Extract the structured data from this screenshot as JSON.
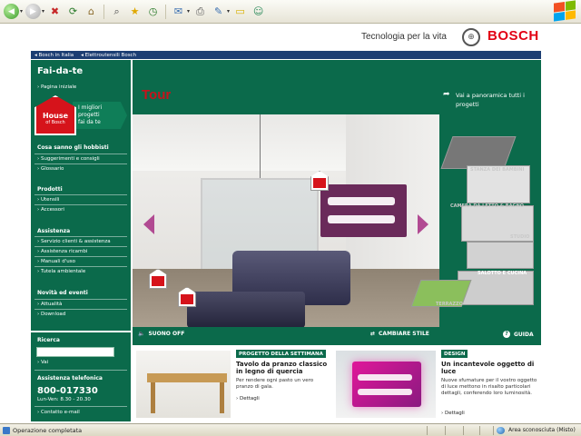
{
  "browser": {
    "toolbar_icons": [
      "back-icon",
      "forward-icon",
      "stop-icon",
      "refresh-icon",
      "home-icon",
      "search-icon",
      "favorites-icon",
      "history-icon",
      "mail-icon",
      "print-icon",
      "edit-icon",
      "discuss-icon"
    ]
  },
  "header": {
    "tagline": "Tecnologia per la vita",
    "brand": "BOSCH"
  },
  "breadcrumb": {
    "items": [
      "Bosch in Italia",
      "Elettroutensili Bosch"
    ]
  },
  "sidebar": {
    "title": "Fai-da-te",
    "home_link": "Pagina iniziale",
    "house_logo_line1": "House",
    "house_logo_line2": "of Bosch",
    "house_text": [
      "I migliori",
      "progetti",
      "fai da te"
    ],
    "section1_title": "Cosa sanno gli hobbisti",
    "section1_items": [
      "Suggerimenti e consigli",
      "Glossario"
    ],
    "section2_title": "Prodotti",
    "section2_items": [
      "Utensili",
      "Accessori"
    ],
    "section3_title": "Assistenza",
    "section3_items": [
      "Servizio clienti & assistenza",
      "Assistenza ricambi",
      "Manuali d'uso",
      "Tutela ambientale"
    ],
    "section4_title": "Novità ed eventi",
    "section4_items": [
      "Attualità",
      "Download"
    ],
    "search_title": "Ricerca",
    "search_go": "Vai",
    "phone_title": "Assistenza telefonica",
    "phone_number": "800-017330",
    "phone_hours": "Lun-Ven:  8.30 - 20.30",
    "contact_link": "Contatto e-mail"
  },
  "tour": {
    "title": "Tour",
    "panorama_link": "Vai a panoramica tutti i progetti",
    "sound_label": "SUONO OFF",
    "style_label": "CAMBIARE STILE",
    "guide_label": "GUIDA",
    "rooms": [
      "STANZA DEI BAMBINI",
      "CAMERA DA LETTO & BAGNO",
      "STUDIO",
      "SALOTTO E CUCINA",
      "TERRAZZO"
    ],
    "active_room": "SALOTTO E CUCINA"
  },
  "features": {
    "week": {
      "tag": "PROGETTO DELLA SETTIMANA",
      "title": "Tavolo da pranzo classico in legno di quercia",
      "body": "Per rendere ogni pasto un vero pranzo di gala.",
      "more": "Dettagli"
    },
    "design": {
      "tag": "DESIGN",
      "title": "Un incantevole oggetto di luce",
      "body": "Nuove sfumature per il vostro oggetto di luce mettono in risalto particolari dettagli, conferendo loro luminosità.",
      "more": "Dettagli"
    }
  },
  "statusbar": {
    "left": "Operazione completata",
    "right": "Area sconosciuta (Misto)"
  },
  "colors": {
    "bosch_green": "#0b6a4b",
    "bosch_red": "#e20015",
    "breadcrumb_blue": "#1c3e73",
    "accent_purple": "#6a2a5a"
  }
}
